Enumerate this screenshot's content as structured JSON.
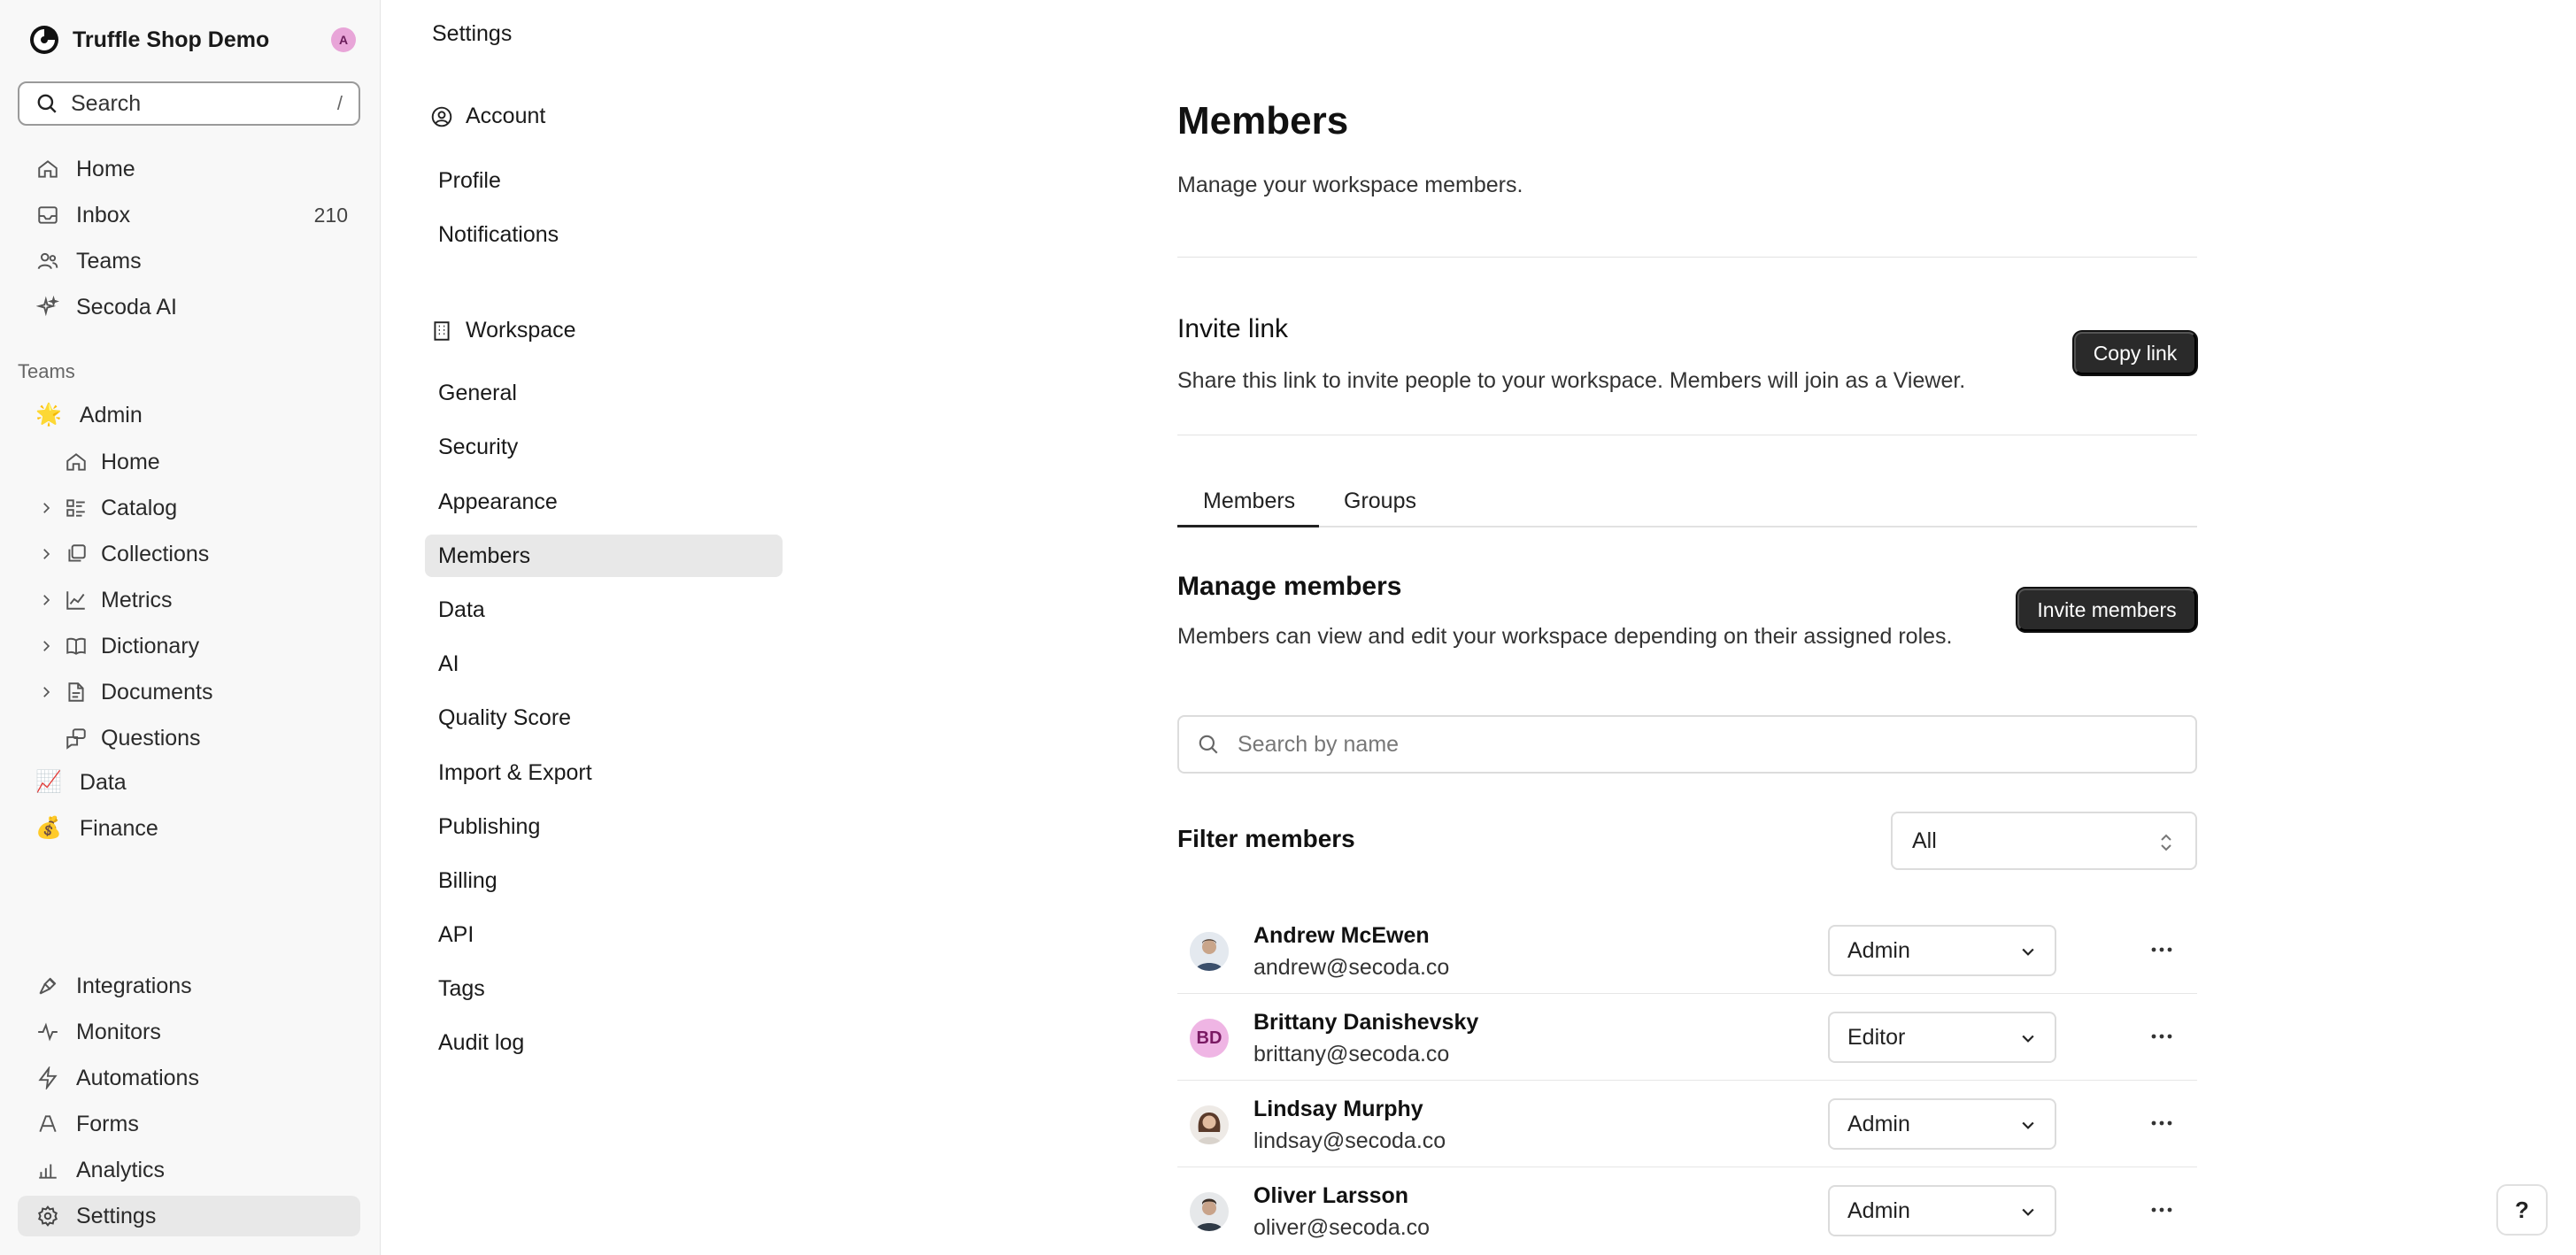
{
  "workspace": {
    "name": "Truffle Shop Demo",
    "avatar_initial": "A"
  },
  "search": {
    "label": "Search",
    "shortcut": "/"
  },
  "primary_nav": [
    {
      "label": "Home",
      "icon": "home-icon"
    },
    {
      "label": "Inbox",
      "icon": "inbox-icon",
      "count": "210"
    },
    {
      "label": "Teams",
      "icon": "users-icon"
    },
    {
      "label": "Secoda AI",
      "icon": "sparkles-icon"
    }
  ],
  "teams_section": {
    "label": "Teams",
    "teams": [
      {
        "label": "Admin",
        "emoji": "🌟"
      },
      {
        "label": "Data",
        "emoji": "📈"
      },
      {
        "label": "Finance",
        "emoji": "💰"
      }
    ],
    "admin_children": [
      {
        "label": "Home",
        "icon": "home-icon"
      },
      {
        "label": "Catalog",
        "icon": "catalog-icon"
      },
      {
        "label": "Collections",
        "icon": "collections-icon"
      },
      {
        "label": "Metrics",
        "icon": "metrics-icon"
      },
      {
        "label": "Dictionary",
        "icon": "book-icon"
      },
      {
        "label": "Documents",
        "icon": "document-icon"
      },
      {
        "label": "Questions",
        "icon": "questions-icon"
      }
    ]
  },
  "bottom_nav": [
    {
      "label": "Integrations",
      "icon": "plug-icon"
    },
    {
      "label": "Monitors",
      "icon": "pulse-icon"
    },
    {
      "label": "Automations",
      "icon": "bolt-icon"
    },
    {
      "label": "Forms",
      "icon": "forms-icon"
    },
    {
      "label": "Analytics",
      "icon": "bar-chart-icon"
    },
    {
      "label": "Settings",
      "icon": "gear-icon"
    }
  ],
  "settings": {
    "title": "Settings",
    "account_label": "Account",
    "account_links": [
      "Profile",
      "Notifications"
    ],
    "workspace_label": "Workspace",
    "workspace_links": [
      "General",
      "Security",
      "Appearance",
      "Members",
      "Data",
      "AI",
      "Quality Score",
      "Import & Export",
      "Publishing",
      "Billing",
      "API",
      "Tags",
      "Audit log"
    ],
    "active_link": "Members"
  },
  "main": {
    "title": "Members",
    "description": "Manage your workspace members.",
    "invite_link": {
      "heading": "Invite link",
      "description": "Share this link to invite people to your workspace. Members will join as a Viewer.",
      "button": "Copy link"
    },
    "tabs": [
      "Members",
      "Groups"
    ],
    "active_tab": "Members",
    "manage": {
      "heading": "Manage members",
      "description": "Members can view and edit your workspace depending on their assigned roles.",
      "button": "Invite members"
    },
    "search_placeholder": "Search by name",
    "filter": {
      "label": "Filter members",
      "value": "All"
    },
    "members": [
      {
        "name": "Andrew McEwen",
        "email": "andrew@secoda.co",
        "role": "Admin",
        "avatar": "photo"
      },
      {
        "name": "Brittany Danishevsky",
        "email": "brittany@secoda.co",
        "role": "Editor",
        "avatar": "initials",
        "initials": "BD"
      },
      {
        "name": "Lindsay Murphy",
        "email": "lindsay@secoda.co",
        "role": "Admin",
        "avatar": "photo"
      },
      {
        "name": "Oliver Larsson",
        "email": "oliver@secoda.co",
        "role": "Admin",
        "avatar": "photo"
      }
    ]
  },
  "help_label": "?"
}
